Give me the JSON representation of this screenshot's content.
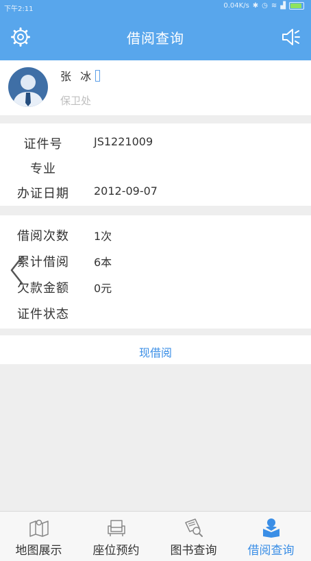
{
  "status_bar": {
    "time": "下午2:11",
    "net_speed": "0.04K/s"
  },
  "header": {
    "title": "借阅查询",
    "left_icon": "gear-icon",
    "right_icon": "speaker-icon"
  },
  "profile": {
    "name": "张 冰",
    "department": "保卫处"
  },
  "card_info": {
    "rows": [
      {
        "label": "证件号",
        "value": "JS1221009"
      },
      {
        "label": "专业",
        "value": ""
      },
      {
        "label": "办证日期",
        "value": "2012-09-07"
      }
    ]
  },
  "borrow_info": {
    "rows": [
      {
        "label": "借阅次数",
        "value": "1次"
      },
      {
        "label": "累计借阅",
        "value": "6本"
      },
      {
        "label": "欠款金额",
        "value": "0元"
      },
      {
        "label": "证件状态",
        "value": ""
      }
    ]
  },
  "current_borrow_link": "现借阅",
  "tabs": [
    {
      "label": "地图展示",
      "icon": "map-icon",
      "active": false
    },
    {
      "label": "座位预约",
      "icon": "seat-icon",
      "active": false
    },
    {
      "label": "图书查询",
      "icon": "book-search-icon",
      "active": false
    },
    {
      "label": "借阅查询",
      "icon": "borrow-query-icon",
      "active": true
    }
  ],
  "colors": {
    "primary": "#58a6ec",
    "active_tab": "#3a8ee6",
    "background": "#eeeeee"
  }
}
